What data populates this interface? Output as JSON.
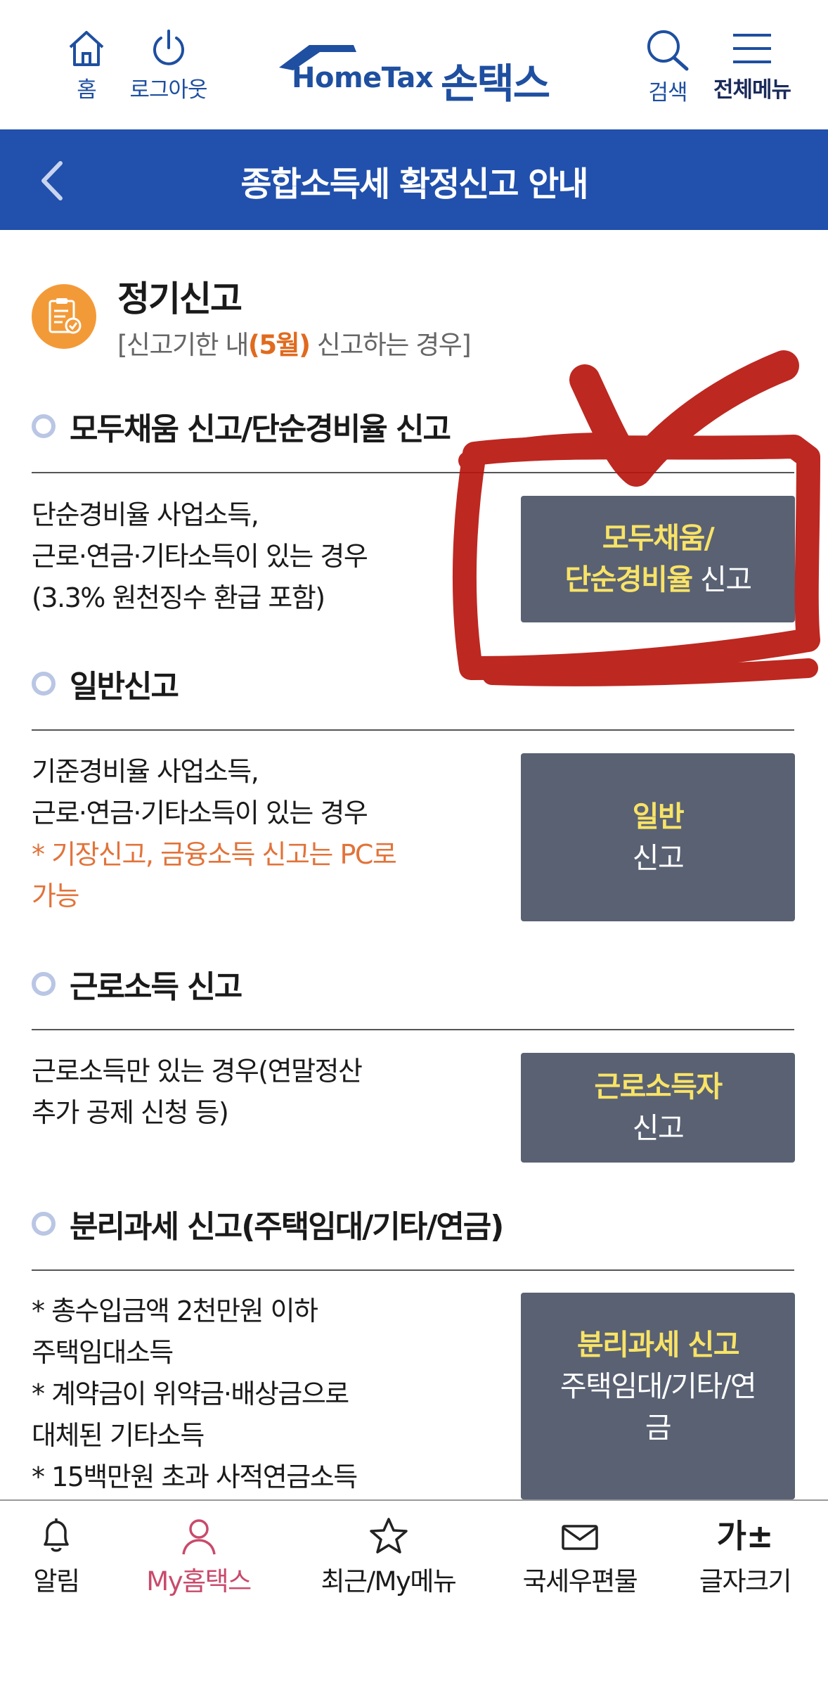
{
  "header": {
    "home_label": "홈",
    "logout_label": "로그아웃",
    "brand_en": "HomeTax",
    "brand_ko": "손택스",
    "search_label": "검색",
    "menu_label": "전체메뉴",
    "brand_color": "#1e4fa0"
  },
  "title_bar": {
    "title": "종합소득세 확정신고 안내",
    "background": "#2150ad"
  },
  "intro": {
    "title": "정기신고",
    "sub_prefix": "[신고기한 내",
    "sub_highlight": "(5월)",
    "sub_suffix": " 신고하는 경우]"
  },
  "sections": [
    {
      "heading": "모두채움 신고/단순경비율 신고",
      "desc_lines": [
        "단순경비율 사업소득,",
        "근로·연금·기타소득이 있는 경우",
        "(3.3% 원천징수 환급 포함)"
      ],
      "button": {
        "yellow_line1": "모두채움/",
        "yellow_line2": "단순경비율",
        "white_suffix": " 신고"
      }
    },
    {
      "heading": "일반신고",
      "desc_lines": [
        "기준경비율 사업소득,",
        "근로·연금·기타소득이 있는 경우"
      ],
      "desc_orange": [
        "* 기장신고, 금융소득 신고는 PC로",
        "가능"
      ],
      "button": {
        "yellow": "일반",
        "white": "신고"
      }
    },
    {
      "heading": "근로소득 신고",
      "desc_lines": [
        "근로소득만 있는 경우(연말정산",
        "추가 공제 신청 등)"
      ],
      "button": {
        "yellow": "근로소득자",
        "white": "신고"
      }
    },
    {
      "heading": "분리과세 신고(주택임대/기타/연금)",
      "desc_lines": [
        "* 총수입금액 2천만원 이하",
        "주택임대소득",
        "* 계약금이 위약금·배상금으로",
        "대체된 기타소득",
        "* 15백만원 초과 사적연금소득"
      ],
      "button": {
        "yellow": "분리과세 신고",
        "white_line1": "주택임대/기타/연",
        "white_line2": "금"
      }
    }
  ],
  "bottom_nav": [
    {
      "label": "알림",
      "icon": "bell-icon"
    },
    {
      "label": "My홈택스",
      "icon": "person-icon",
      "active": true
    },
    {
      "label": "최근/My메뉴",
      "icon": "star-icon"
    },
    {
      "label": "국세우편물",
      "icon": "mail-icon"
    },
    {
      "label": "글자크기",
      "icon": "font-size-icon",
      "glyph": "가±"
    }
  ],
  "colors": {
    "button_bg": "#596173",
    "button_highlight": "#f8e366",
    "orange_text": "#e2733a",
    "annotation_red": "#b8160f"
  }
}
